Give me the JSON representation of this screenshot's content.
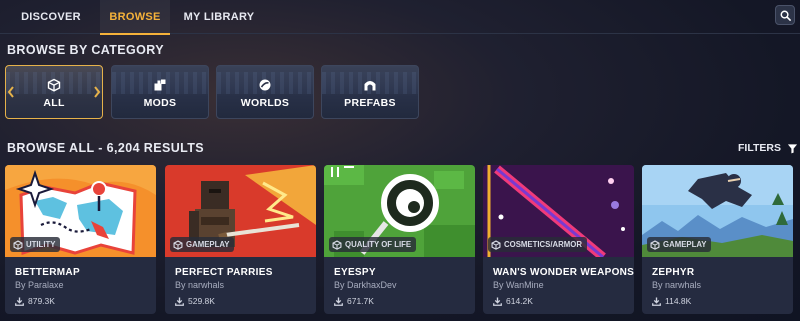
{
  "nav": {
    "tabs": [
      {
        "label": "DISCOVER",
        "active": false
      },
      {
        "label": "BROWSE",
        "active": true
      },
      {
        "label": "MY LIBRARY",
        "active": false
      }
    ],
    "search_icon": "search-icon"
  },
  "category_section": {
    "heading": "BROWSE BY CATEGORY",
    "categories": [
      {
        "label": "ALL",
        "icon": "cube-icon",
        "active": true
      },
      {
        "label": "MODS",
        "icon": "puzzle-icon",
        "active": false
      },
      {
        "label": "WORLDS",
        "icon": "globe-icon",
        "active": false
      },
      {
        "label": "PREFABS",
        "icon": "arch-icon",
        "active": false
      }
    ]
  },
  "results": {
    "heading": "BROWSE ALL - 6,204 RESULTS",
    "filters_label": "FILTERS",
    "cards": [
      {
        "title": "BETTERMAP",
        "author": "By Paralaxe",
        "downloads": "879.3K",
        "tag": "UTILITY"
      },
      {
        "title": "PERFECT PARRIES",
        "author": "By narwhals",
        "downloads": "529.8K",
        "tag": "GAMEPLAY"
      },
      {
        "title": "EYESPY",
        "author": "By DarkhaxDev",
        "downloads": "671.7K",
        "tag": "QUALITY OF LIFE"
      },
      {
        "title": "WAN'S WONDER WEAPONS",
        "author": "By WanMine",
        "downloads": "614.2K",
        "tag": "COSMETICS/ARMOR"
      },
      {
        "title": "ZEPHYR",
        "author": "By narwhals",
        "downloads": "114.8K",
        "tag": "GAMEPLAY"
      }
    ]
  },
  "colors": {
    "accent": "#f5b23a",
    "background": "#141726",
    "card": "#252b40"
  }
}
